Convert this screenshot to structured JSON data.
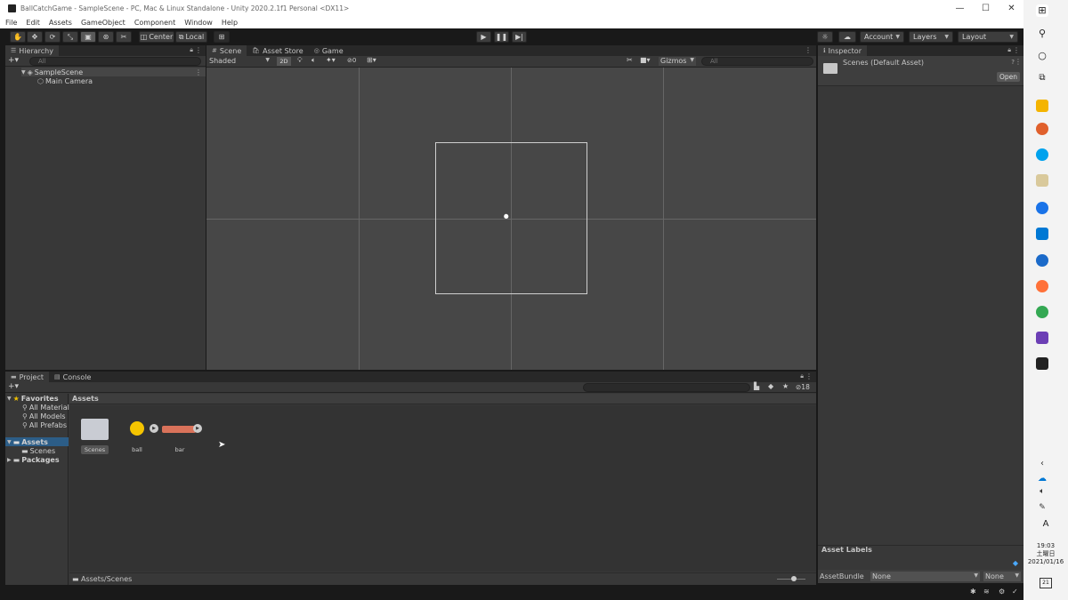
{
  "window": {
    "title": "BallCatchGame - SampleScene - PC, Mac & Linux Standalone - Unity 2020.2.1f1 Personal <DX11>",
    "minimize": "—",
    "maximize": "☐",
    "close": "✕"
  },
  "menu": [
    "File",
    "Edit",
    "Assets",
    "GameObject",
    "Component",
    "Window",
    "Help"
  ],
  "toolbar": {
    "pivot": "Center",
    "space": "Local",
    "account": "Account",
    "layers": "Layers",
    "layout": "Layout"
  },
  "hierarchy": {
    "tab": "Hierarchy",
    "search_placeholder": "All",
    "scene": "SampleScene",
    "children": [
      "Main Camera"
    ]
  },
  "scene_view": {
    "tabs": [
      "Scene",
      "Asset Store",
      "Game"
    ],
    "draw_mode": "Shaded",
    "mode_2d": "2D",
    "hidden_count": "0",
    "gizmos": "Gizmos",
    "search_placeholder": "All"
  },
  "inspector": {
    "tab": "Inspector",
    "asset_title": "Scenes (Default Asset)",
    "open_button": "Open",
    "asset_labels": "Asset Labels",
    "assetbundle_label": "AssetBundle",
    "assetbundle_value": "None",
    "variant_value": "None"
  },
  "project": {
    "tabs": [
      "Project",
      "Console"
    ],
    "favorites": "Favorites",
    "favorite_items": [
      "All Material",
      "All Models",
      "All Prefabs"
    ],
    "assets_root": "Assets",
    "assets_children": [
      "Scenes"
    ],
    "packages": "Packages",
    "breadcrumb": "Assets",
    "hidden_count": "18",
    "items": [
      {
        "name": "Scenes",
        "kind": "folder"
      },
      {
        "name": "ball",
        "kind": "sprite-circle",
        "color": "#f5c400"
      },
      {
        "name": "bar",
        "kind": "sprite-bar",
        "color": "#d9725a"
      }
    ],
    "path": "Assets/Scenes"
  },
  "taskbar": {
    "time": "19:03",
    "weekday": "土曜日",
    "date": "2021/01/16",
    "ime": "A",
    "notifications": "21"
  }
}
